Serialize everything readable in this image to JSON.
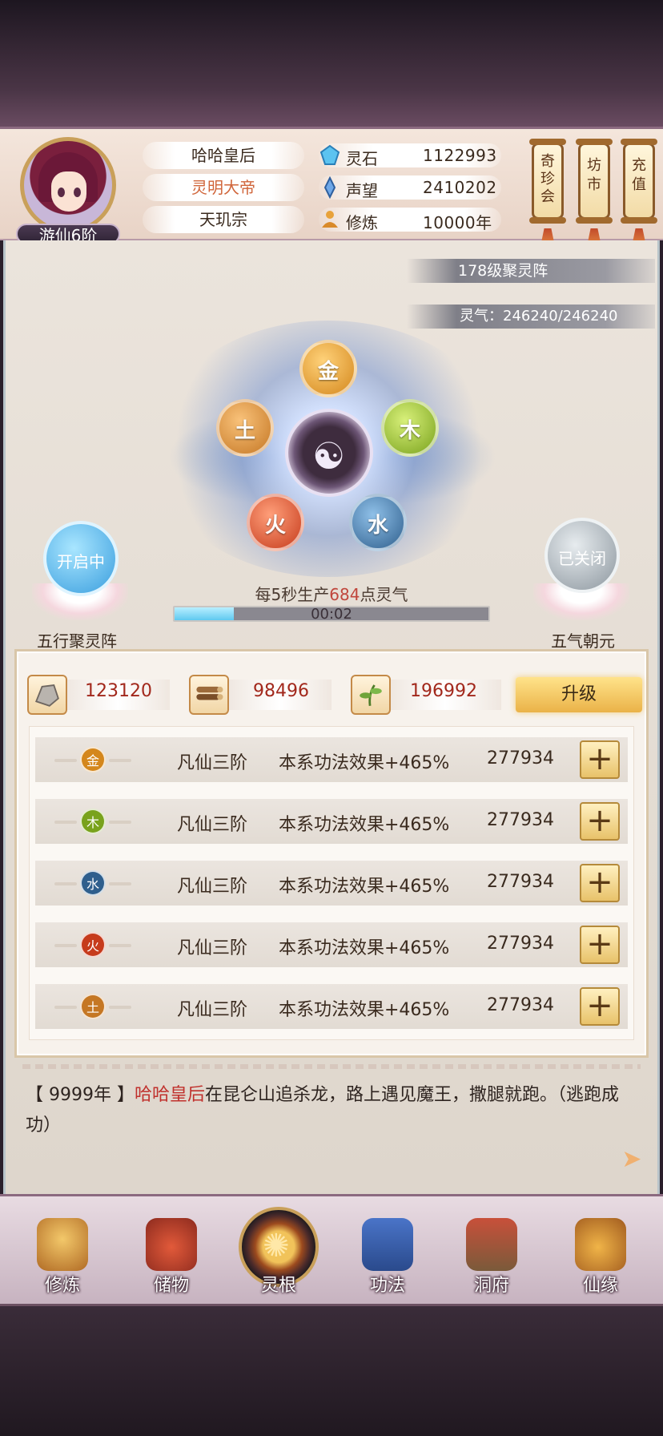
{
  "header": {
    "player_rank": "游仙6阶",
    "player_name": "哈哈皇后",
    "player_title": "灵明大帝",
    "sect": "天玑宗",
    "stats": [
      {
        "icon": "spirit-stone-icon",
        "label": "灵石",
        "value": "1122993"
      },
      {
        "icon": "reputation-icon",
        "label": "声望",
        "value": "2410202"
      },
      {
        "icon": "cultivation-icon",
        "label": "修炼",
        "value": "10000年"
      }
    ],
    "menu_buttons": [
      {
        "name": "treasure-hall-button",
        "label": "奇珍会"
      },
      {
        "name": "market-button",
        "label": "坊市"
      },
      {
        "name": "recharge-button",
        "label": "充值"
      }
    ]
  },
  "array": {
    "level_label": "178级聚灵阵",
    "qi_label": "灵气：246240/246240",
    "center_glyph": "☯",
    "elements": {
      "jin": "金",
      "mu": "木",
      "shui": "水",
      "huo": "火",
      "tu": "土"
    },
    "left_orb": {
      "status": "开启中",
      "label": "五行聚灵阵"
    },
    "right_orb": {
      "status": "已关闭",
      "label": "五气朝元"
    },
    "produce_prefix": "每5秒生产",
    "produce_value": "684",
    "produce_suffix": "点灵气",
    "timer": "00:02",
    "progress": 0.19
  },
  "resources": [
    {
      "icon": "ore-icon",
      "value": "123120"
    },
    {
      "icon": "wood-icon",
      "value": "98496"
    },
    {
      "icon": "herb-icon",
      "value": "196992"
    }
  ],
  "upgrade_label": "升级",
  "element_rows": [
    {
      "element": "金",
      "color": "#d4871c",
      "rank": "凡仙三阶",
      "effect": "本系功法效果+465%",
      "value": "277934"
    },
    {
      "element": "木",
      "color": "#79a21c",
      "rank": "凡仙三阶",
      "effect": "本系功法效果+465%",
      "value": "277934"
    },
    {
      "element": "水",
      "color": "#2f5f8d",
      "rank": "凡仙三阶",
      "effect": "本系功法效果+465%",
      "value": "277934"
    },
    {
      "element": "火",
      "color": "#c63b1c",
      "rank": "凡仙三阶",
      "effect": "本系功法效果+465%",
      "value": "277934"
    },
    {
      "element": "土",
      "color": "#c57724",
      "rank": "凡仙三阶",
      "effect": "本系功法效果+465%",
      "value": "277934"
    }
  ],
  "plus_label": "+",
  "log": {
    "year": "【 9999年 】",
    "name": "哈哈皇后",
    "text": "在昆仑山追杀龙，路上遇见魔王，撒腿就跑。（逃跑成功）"
  },
  "nav": [
    {
      "name": "nav-cultivate",
      "label": "修炼"
    },
    {
      "name": "nav-storage",
      "label": "储物"
    },
    {
      "name": "nav-spirit-root",
      "label": "灵根"
    },
    {
      "name": "nav-technique",
      "label": "功法"
    },
    {
      "name": "nav-cave",
      "label": "洞府"
    },
    {
      "name": "nav-fate",
      "label": "仙缘"
    }
  ]
}
